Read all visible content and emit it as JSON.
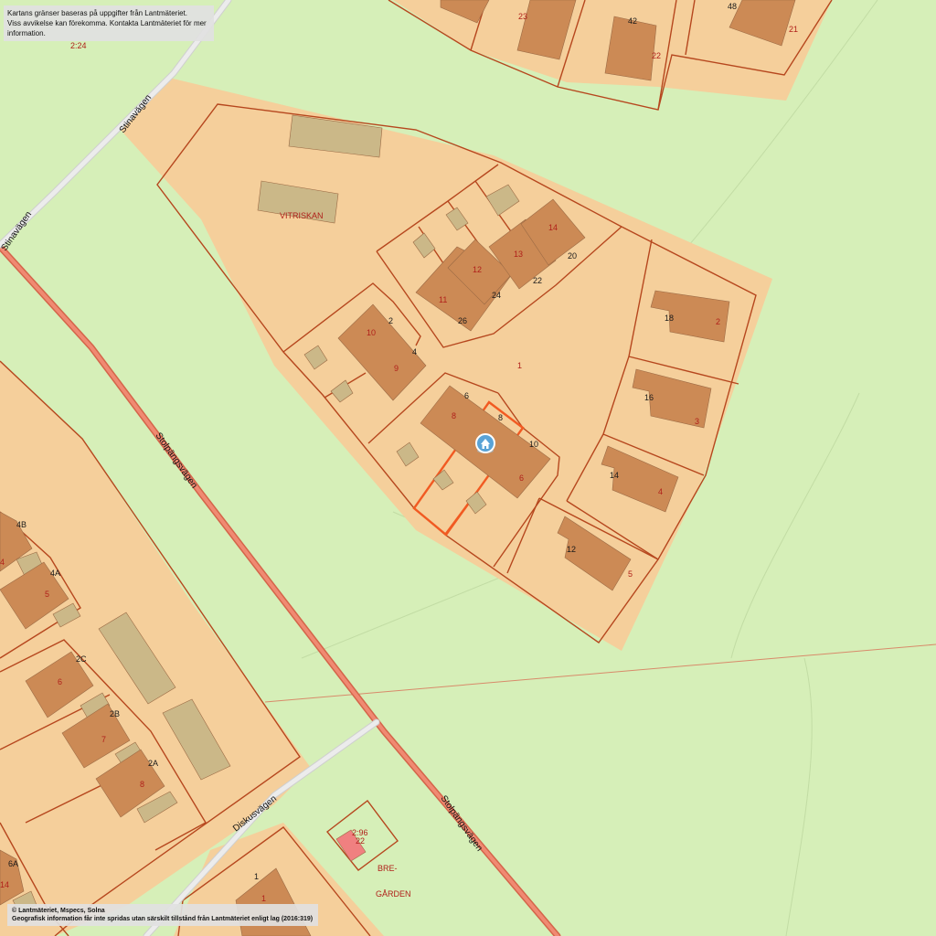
{
  "notices": {
    "top_line1": "Kartans gränser baseras på uppgifter från Lantmäteriet.",
    "top_line2": "Viss avvikelse kan förekomma. Kontakta Lantmäteriet för mer information.",
    "bottom_line1": "© Lantmäteriet, Mspecs, Solna",
    "bottom_line2": "Geografisk information får inte spridas utan särskilt tillstånd från Lantmäteriet enligt lag (2016:319)"
  },
  "roads": {
    "stinavagen_upper": "Stinavägen",
    "stinavagen_lower": "Stinavägen",
    "stolpangsvagen_upper": "Stolpängsvägen",
    "stolpangsvagen_lower": "Stolpängsvägen",
    "diskusvagen": "Diskusvägen"
  },
  "areas": {
    "vitriskan": "VITRISKAN",
    "bregarden_line1": "BRE-",
    "bregarden_line2": "GÅRDEN"
  },
  "labels": {
    "parcel_2_24": "2:24",
    "parcel_2_96": "2:96",
    "p23_top": "23",
    "p22_top": "22",
    "p21_top": "21",
    "a42": "42",
    "a48": "48",
    "p14": "14",
    "p13": "13",
    "p12": "12",
    "p11": "11",
    "a20": "20",
    "a22": "22",
    "a24": "24",
    "a26": "26",
    "p10": "10",
    "p9": "9",
    "a2": "2",
    "a4": "4",
    "p1": "1",
    "a6": "6",
    "a8": "8",
    "a10": "10",
    "p8": "8",
    "p6": "6",
    "a18": "18",
    "p2": "2",
    "a16": "16",
    "p3": "3",
    "a14": "14",
    "p4": "4",
    "a12": "12",
    "p5": "5",
    "a4B": "4B",
    "p4_left": "4",
    "a4A": "4A",
    "p5_left": "5",
    "a2C": "2C",
    "p6_left": "6",
    "a2B": "2B",
    "p7_left": "7",
    "a2A": "2A",
    "p8_left": "8",
    "a6A": "6A",
    "p14_left": "14",
    "a22_bottom": "22",
    "a1_bottom": "1",
    "p1_bottom": "1"
  },
  "colors": {
    "background": "#d6efb8",
    "residential": "#f5cf9b",
    "building": "#cc8a55",
    "outbuilding": "#cbb888",
    "boundary": "#b6471e",
    "selected_boundary": "#f15a22",
    "main_road": "#f08a72",
    "minor_road": "#e2e2e2"
  },
  "marker": {
    "icon": "house-pin-icon"
  }
}
